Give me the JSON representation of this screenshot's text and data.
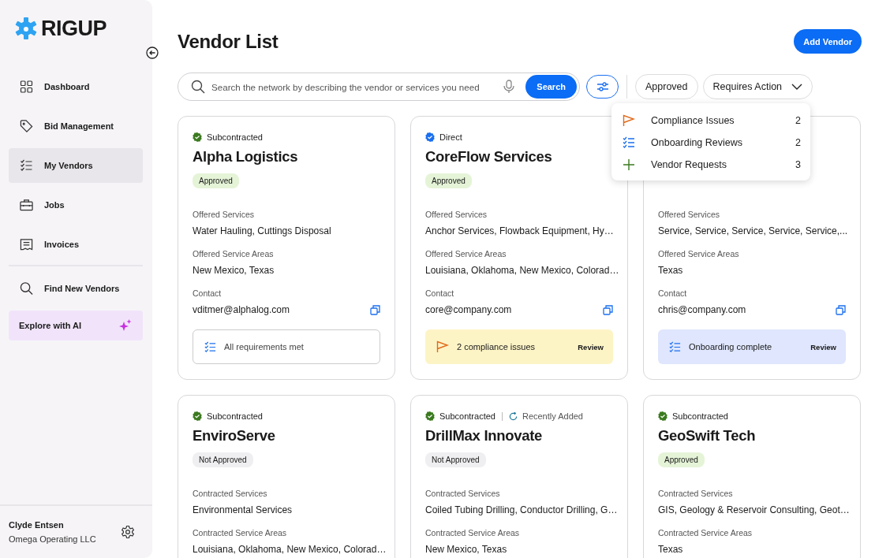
{
  "sidebar": {
    "logo": "RIGUP",
    "nav": [
      {
        "label": "Dashboard",
        "kind": "grid",
        "selected": false
      },
      {
        "label": "Bid Management",
        "kind": "tag",
        "selected": false
      },
      {
        "label": "My Vendors",
        "kind": "checklist",
        "selected": true
      },
      {
        "label": "Jobs",
        "kind": "briefcase",
        "selected": false
      },
      {
        "label": "Invoices",
        "kind": "receipt",
        "selected": false
      }
    ],
    "find": {
      "label": "Find New Vendors"
    },
    "explore": {
      "label": "Explore with AI"
    },
    "user": {
      "name": "Clyde Entsen",
      "company": "Omega Operating LLC"
    }
  },
  "header": {
    "title": "Vendor List",
    "add_button": "Add Vendor"
  },
  "toolbar": {
    "search": {
      "placeholder": "Search the network by describing the vendor or services you need",
      "button": "Search"
    },
    "filters": [
      {
        "label": "Approved",
        "dropdown": false
      },
      {
        "label": "Requires Action",
        "dropdown": true
      }
    ]
  },
  "dropdown": [
    {
      "label": "Compliance Issues",
      "count": "2",
      "kind": "flag"
    },
    {
      "label": "Onboarding Reviews",
      "count": "2",
      "kind": "checklist"
    },
    {
      "label": "Vendor Requests",
      "count": "3",
      "kind": "plus"
    }
  ],
  "cards": [
    {
      "type": {
        "label": "Subcontracted",
        "color": "#3b7a1f"
      },
      "name": "Alpha Logistics",
      "status": {
        "label": "Approved",
        "kind": "approved"
      },
      "fields": [
        {
          "label": "Offered Services",
          "value": "Water Hauling, Cuttings Disposal"
        },
        {
          "label": "Offered Service Areas",
          "value": "New Mexico, Texas"
        },
        {
          "label": "Contact",
          "value": "vditmer@alphalog.com",
          "kind": "contact"
        }
      ],
      "footer": {
        "kind": "met",
        "text": "All requirements met"
      }
    },
    {
      "type": {
        "label": "Direct",
        "color": "#1a6ff0"
      },
      "name": "CoreFlow Services",
      "status": {
        "label": "Approved",
        "kind": "approved"
      },
      "fields": [
        {
          "label": "Offered Services",
          "value": "Anchor Services, Flowback Equipment, Hy…"
        },
        {
          "label": "Offered Service Areas",
          "value": "Louisiana, Oklahoma, New Mexico, Colorad…"
        },
        {
          "label": "Contact",
          "value": "core@company.com",
          "kind": "contact"
        }
      ],
      "footer": {
        "kind": "compliance",
        "text": "2 compliance issues",
        "action": "Review"
      }
    },
    {
      "fields": [
        {
          "label": "Offered Services",
          "value": "Service, Service, Service, Service, Service,..."
        },
        {
          "label": "Offered Service Areas",
          "value": "Texas"
        },
        {
          "label": "Contact",
          "value": "chris@company.com",
          "kind": "contact"
        }
      ],
      "footer": {
        "kind": "onboarding",
        "text": "Onboarding complete",
        "action": "Review"
      }
    },
    {
      "type": {
        "label": "Subcontracted",
        "color": "#3b7a1f"
      },
      "name": "EnviroServe",
      "status": {
        "label": "Not Approved",
        "kind": "not_approved"
      },
      "fields": [
        {
          "label": "Contracted Services",
          "value": "Environmental Services"
        },
        {
          "label": "Contracted Service Areas",
          "value": "Louisiana, Oklahoma, New Mexico, Colorad…"
        }
      ]
    },
    {
      "type": {
        "label": "Subcontracted",
        "color": "#3b7a1f"
      },
      "extra": "Recently Added",
      "name": "DrillMax Innovate",
      "status": {
        "label": "Not Approved",
        "kind": "not_approved"
      },
      "fields": [
        {
          "label": "Contracted Services",
          "value": "Coiled Tubing Drilling, Conductor Drilling, G…"
        },
        {
          "label": "Contracted Service Areas",
          "value": "New Mexico, Texas"
        }
      ]
    },
    {
      "type": {
        "label": "Subcontracted",
        "color": "#3b7a1f"
      },
      "name": "GeoSwift Tech",
      "status": {
        "label": "Approved",
        "kind": "approved"
      },
      "fields": [
        {
          "label": "Contracted Services",
          "value": "GIS, Geology & Reservoir Consulting, Geot…"
        },
        {
          "label": "Contracted Service Areas",
          "value": "Texas"
        }
      ]
    }
  ]
}
